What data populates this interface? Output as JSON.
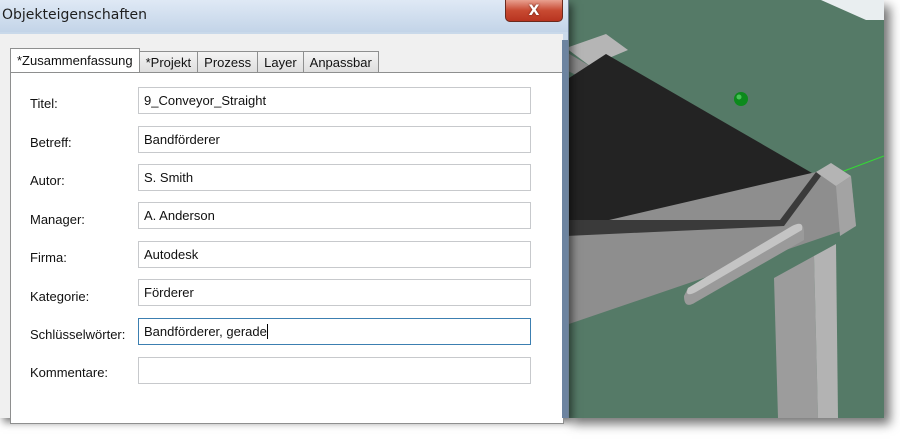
{
  "window": {
    "title": "Objekteigenschaften",
    "close_glyph": "X"
  },
  "tabs": [
    {
      "label": "*Zusammenfassung"
    },
    {
      "label": "*Projekt"
    },
    {
      "label": "Prozess"
    },
    {
      "label": "Layer"
    },
    {
      "label": "Anpassbar"
    }
  ],
  "fields": [
    {
      "label": "Titel:",
      "value": "9_Conveyor_Straight"
    },
    {
      "label": "Betreff:",
      "value": "Bandförderer"
    },
    {
      "label": "Autor:",
      "value": "S. Smith"
    },
    {
      "label": "Manager:",
      "value": "A. Anderson"
    },
    {
      "label": "Firma:",
      "value": "Autodesk"
    },
    {
      "label": "Kategorie:",
      "value": "Förderer"
    },
    {
      "label": "Schlüsselwörter:",
      "value": "Bandförderer, gerade"
    },
    {
      "label": "Kommentare:",
      "value": ""
    }
  ],
  "colors": {
    "viewport_bg": "#557a67",
    "close_button": "#c84a32",
    "focus_border": "#3c7fb1"
  },
  "icons": {
    "close": "close-icon",
    "marker": "green-sphere-marker"
  }
}
